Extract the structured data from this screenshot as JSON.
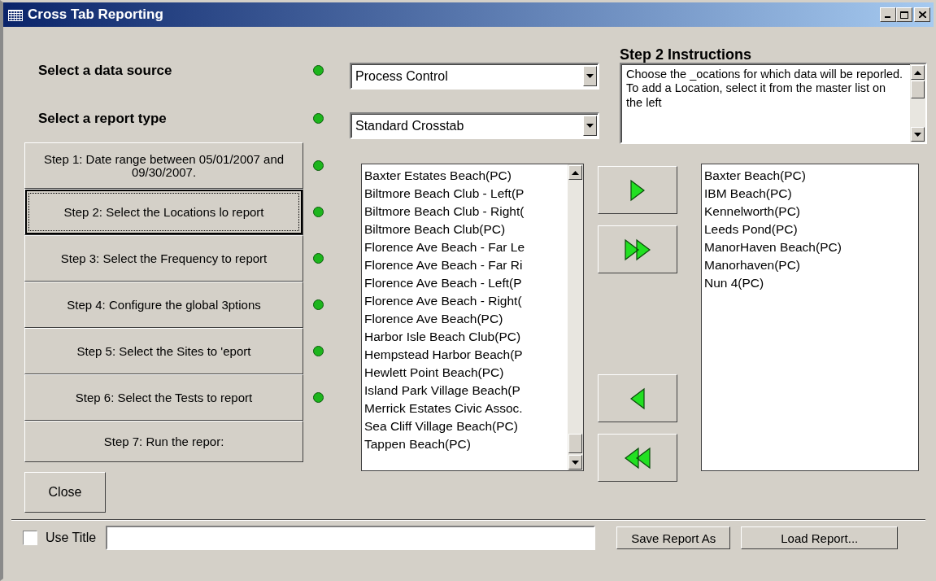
{
  "window": {
    "title": "Cross Tab Reporting"
  },
  "selectors": [
    {
      "label": "Select a data source",
      "done": true,
      "value": "Process Control"
    },
    {
      "label": "Select a report type",
      "done": true,
      "value": "Standard Crosstab"
    }
  ],
  "steps": [
    {
      "label": "Step 1: Date range between 05/01/2007 and 09/30/2007.",
      "done": true,
      "selected": false
    },
    {
      "label": "Step 2: Select the Locations lo report",
      "done": true,
      "selected": true
    },
    {
      "label": "Step 3: Select the Frequency to report",
      "done": true,
      "selected": false
    },
    {
      "label": "Step 4: Configure the global 3ptions",
      "done": true,
      "selected": false
    },
    {
      "label": "Step 5: Select the Sites to 'eport",
      "done": true,
      "selected": false
    },
    {
      "label": "Step 6: Select the Tests to report",
      "done": true,
      "selected": false
    },
    {
      "label": "Step 7: Run the repor:",
      "done": false,
      "selected": false
    }
  ],
  "close_button": "Close",
  "instructions": {
    "heading": "Step 2 Instructions",
    "text": "Choose the _ocations for which data will be reporled.  To add a Location, select it from the master list on the left"
  },
  "master_list": [
    "Baxter Estates Beach(PC)",
    "Biltmore Beach Club - Left(P",
    "Biltmore Beach Club - Right(",
    "Biltmore Beach Club(PC)",
    "Florence Ave Beach - Far Le",
    "Florence Ave Beach - Far Ri",
    "Florence Ave Beach - Left(P",
    "Florence Ave Beach - Right(",
    "Florence Ave Beach(PC)",
    "Harbor Isle Beach Club(PC)",
    "Hempstead Harbor Beach(P",
    "Hewlett Point Beach(PC)",
    "Island Park Village Beach(P",
    "Merrick Estates Civic Assoc.",
    "Sea Cliff Village Beach(PC)",
    "Tappen Beach(PC)"
  ],
  "move_buttons": [
    {
      "kind": "add"
    },
    {
      "kind": "add_all"
    },
    {
      "kind": "remove"
    },
    {
      "kind": "remove_all"
    }
  ],
  "selected_list": [
    "Baxter Beach(PC)",
    "IBM Beach(PC)",
    "Kennelworth(PC)",
    "Leeds Pond(PC)",
    "ManorHaven Beach(PC)",
    "Manorhaven(PC)",
    "Nun 4(PC)"
  ],
  "footer": {
    "use_title": {
      "label": "Use Title",
      "checked": false
    },
    "buttons": [
      "Save Report As",
      "Load Report..."
    ]
  }
}
